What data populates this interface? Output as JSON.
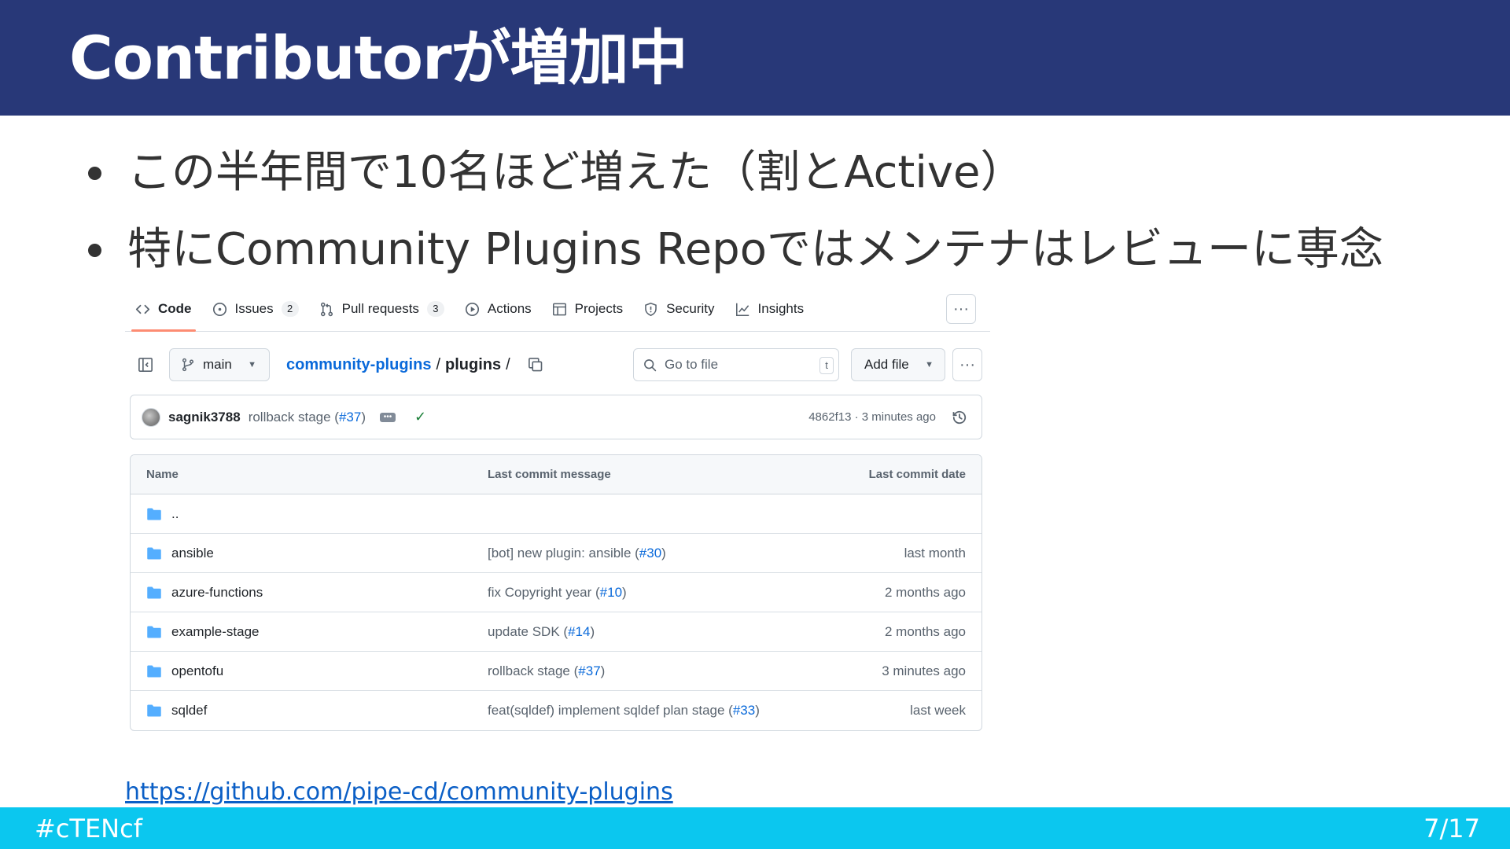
{
  "slide": {
    "title": "Contributorが増加中",
    "bullets": [
      "この半年間で10名ほど増えた（割とActive）",
      "特にCommunity Plugins Repoではメンテナはレビューに専念"
    ],
    "link_text": "https://github.com/pipe-cd/community-plugins",
    "footer_hashtag": "#cTENcf",
    "page_indicator": "7/17"
  },
  "github": {
    "tabs": [
      {
        "label": "Code",
        "icon": "code-icon",
        "active": true
      },
      {
        "label": "Issues",
        "icon": "issue-icon",
        "count": "2"
      },
      {
        "label": "Pull requests",
        "icon": "pull-request-icon",
        "count": "3"
      },
      {
        "label": "Actions",
        "icon": "play-icon"
      },
      {
        "label": "Projects",
        "icon": "table-icon"
      },
      {
        "label": "Security",
        "icon": "shield-icon"
      },
      {
        "label": "Insights",
        "icon": "graph-icon"
      }
    ],
    "more_label": "···",
    "branch": "main",
    "breadcrumb": {
      "repo": "community-plugins",
      "sep": "/",
      "dir": "plugins",
      "trailing": "/"
    },
    "search_placeholder": "Go to file",
    "search_shortcut": "t",
    "add_file_label": "Add file",
    "latest_commit": {
      "author": "sagnik3788",
      "message": "rollback stage (",
      "pr": "#37",
      "message_end": ")",
      "meta": "4862f13 · 3 minutes ago"
    },
    "table": {
      "headers": {
        "name": "Name",
        "message": "Last commit message",
        "date": "Last commit date"
      },
      "rows": [
        {
          "name": "..",
          "message": "",
          "pr": "",
          "date": ""
        },
        {
          "name": "ansible",
          "message": "[bot] new plugin: ansible (",
          "pr": "#30",
          "date": "last month"
        },
        {
          "name": "azure-functions",
          "message": "fix Copyright year (",
          "pr": "#10",
          "date": "2 months ago"
        },
        {
          "name": "example-stage",
          "message": "update SDK (",
          "pr": "#14",
          "date": "2 months ago"
        },
        {
          "name": "opentofu",
          "message": "rollback stage (",
          "pr": "#37",
          "date": "3 minutes ago"
        },
        {
          "name": "sqldef",
          "message": "feat(sqldef) implement sqldef plan stage (",
          "pr": "#33",
          "date": "last week"
        }
      ]
    }
  },
  "colors": {
    "header_bg": "#283878",
    "footer_bg": "#0bc7ef",
    "link": "#0969da",
    "folder": "#54aeff",
    "active_tab_underline": "#fd8c73"
  }
}
